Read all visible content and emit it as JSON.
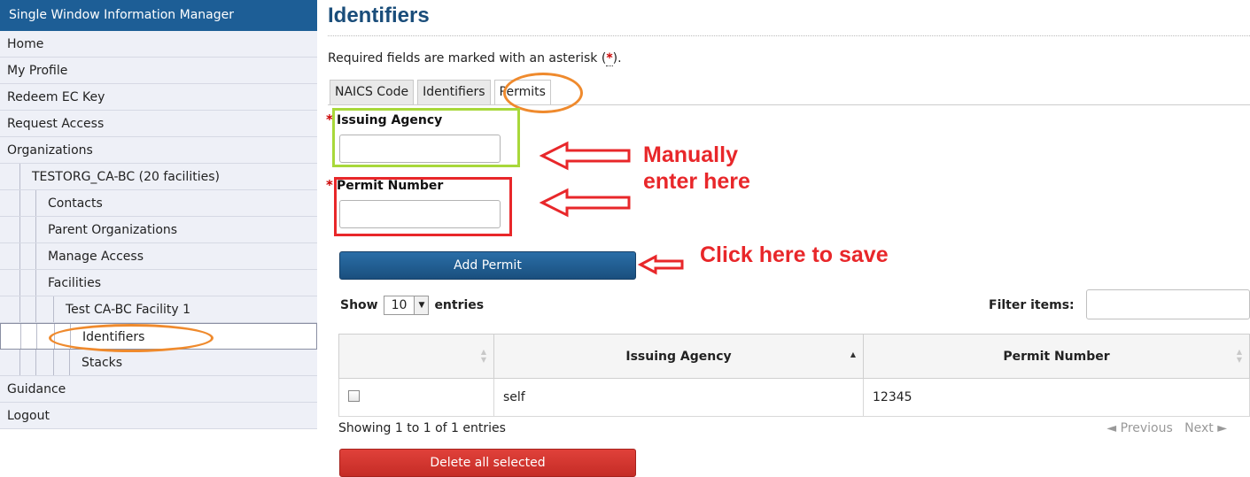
{
  "app": {
    "title": "Single Window Information Manager"
  },
  "sidebar": {
    "home": "Home",
    "my_profile": "My Profile",
    "redeem": "Redeem EC Key",
    "request_access": "Request Access",
    "organizations": "Organizations",
    "org": "TESTORG_CA-BC (20 facilities)",
    "contacts": "Contacts",
    "parent_orgs": "Parent Organizations",
    "manage_access": "Manage Access",
    "facilities": "Facilities",
    "facility": "Test CA-BC Facility 1",
    "identifiers": "Identifiers",
    "stacks": "Stacks",
    "guidance": "Guidance",
    "logout": "Logout"
  },
  "page": {
    "title": "Identifiers",
    "required_prefix": "Required fields are marked with an asterisk (",
    "required_star": "*",
    "required_suffix": ")."
  },
  "tabs": [
    "NAICS Code",
    "Identifiers",
    "Permits"
  ],
  "form": {
    "star": "*",
    "issuing_agency_label": "Issuing Agency",
    "issuing_agency_value": "",
    "permit_number_label": "Permit Number",
    "permit_number_value": "",
    "add_button": "Add Permit"
  },
  "listing": {
    "show": "Show",
    "entries_count": "10",
    "entries": "entries",
    "filter_label": "Filter items:",
    "filter_value": ""
  },
  "table": {
    "headers": [
      "",
      "Issuing Agency",
      "Permit Number"
    ],
    "rows": [
      {
        "agency": "self",
        "permit": "12345"
      }
    ]
  },
  "footer": {
    "info": "Showing 1 to 1 of 1 entries",
    "previous": "◄ Previous",
    "next": "Next ►",
    "delete_button": "Delete all selected"
  },
  "annotations": {
    "manual_line1": "Manually",
    "manual_line2": "enter here",
    "click_save": "Click here to save"
  },
  "colors": {
    "sidebar_header": "#1d5e96",
    "annotation_red": "#e8272a",
    "highlight_green": "#a8d83a",
    "highlight_orange": "#ef8a2d",
    "button_blue": "#1a4f7e",
    "button_red": "#c52c26"
  }
}
